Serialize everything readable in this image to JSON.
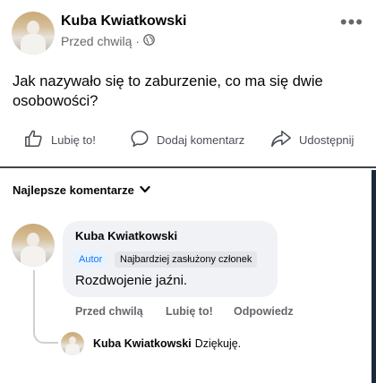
{
  "post": {
    "author": "Kuba Kwiatkowski",
    "time": "Przed chwilą",
    "separator": "·",
    "text": "Jak nazywało się to zaburzenie, co ma się dwie osobowości?",
    "more_label": "•••"
  },
  "actions": {
    "like": "Lubię to!",
    "comment": "Dodaj komentarz",
    "share": "Udostępnij"
  },
  "comments_filter": "Najlepsze komentarze",
  "comment": {
    "author": "Kuba Kwiatkowski",
    "badges": [
      "Autor",
      "Najbardziej zasłużony członek"
    ],
    "text": "Rozdwojenie jaźni.",
    "time": "Przed chwilą",
    "like": "Lubię to!",
    "reply": "Odpowiedz"
  },
  "reply": {
    "author": "Kuba Kwiatkowski",
    "text": "Dziękuję."
  },
  "colors": {
    "link_blue": "#1877f2",
    "secondary_text": "#65676b",
    "bubble_bg": "#f0f2f5"
  }
}
